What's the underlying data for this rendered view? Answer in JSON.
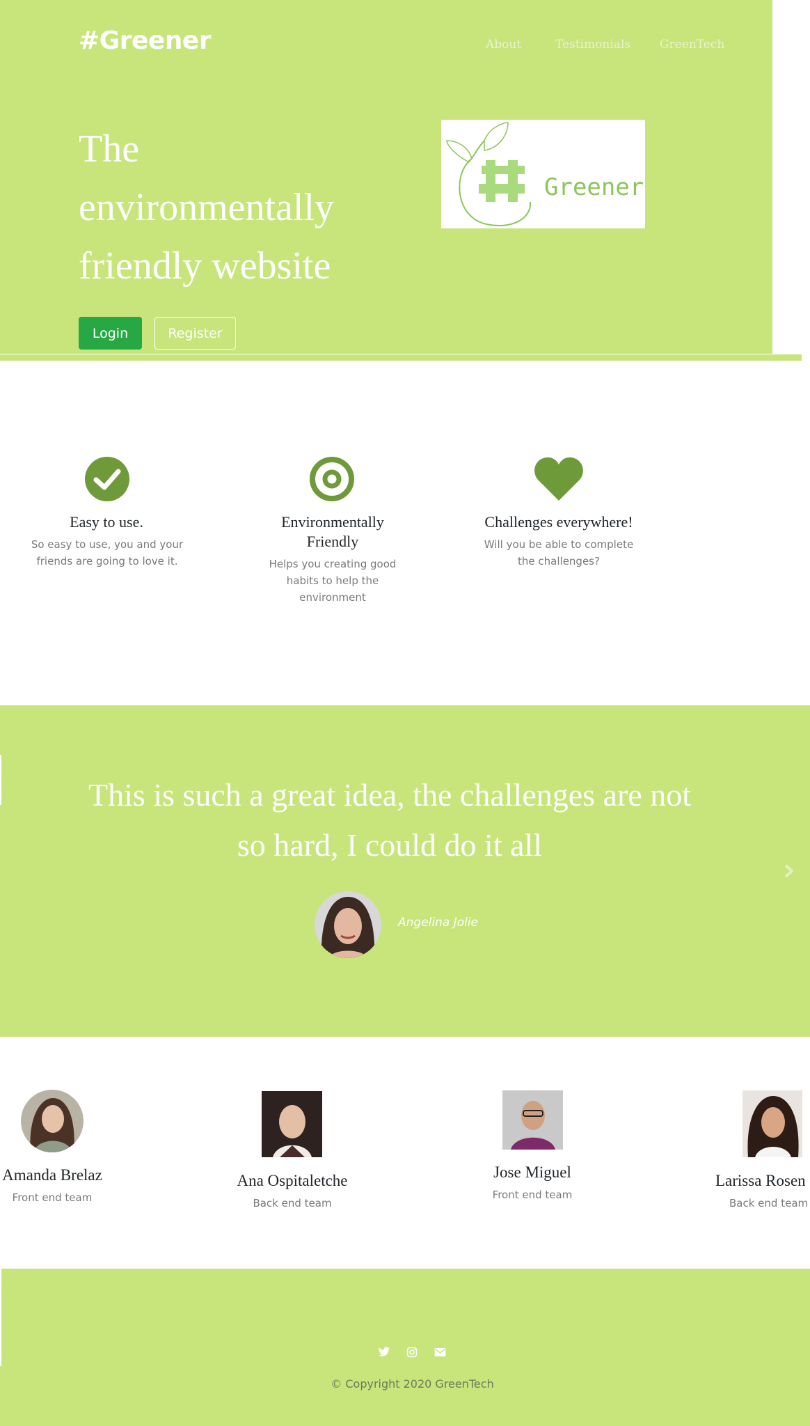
{
  "header": {
    "brand": "#Greener",
    "nav": [
      {
        "label": "About"
      },
      {
        "label": "Testimonials"
      },
      {
        "label": "GreenTech"
      }
    ]
  },
  "hero": {
    "title_lines": [
      "The",
      "environmentally",
      "friendly website"
    ],
    "login_label": "Login",
    "register_label": "Register",
    "logo_text": "Greener"
  },
  "features": [
    {
      "icon": "check-circle-icon",
      "title": "Easy to use.",
      "desc_lines": [
        "So easy to use, you and your",
        "friends are going to love it."
      ]
    },
    {
      "icon": "target-icon",
      "title_lines": [
        "Environmentally",
        "Friendly"
      ],
      "desc_lines": [
        "Helps you creating good",
        "habits to help the",
        "environment"
      ]
    },
    {
      "icon": "heart-icon",
      "title": "Challenges everywhere!",
      "desc_lines": [
        "Will you be able to complete",
        "the challenges?"
      ]
    }
  ],
  "testimonial": {
    "quote_lines": [
      "This is such a great idea, the challenges are not",
      "so hard, I could do it all"
    ],
    "author": "Angelina Jolie",
    "next_icon": "chevron-right-icon"
  },
  "team": [
    {
      "name": "Amanda Brelaz",
      "role": "Front end team"
    },
    {
      "name": "Ana Ospitaletche",
      "role": "Back end team"
    },
    {
      "name": "Jose Miguel",
      "role": "Front end team"
    },
    {
      "name": "Larissa Rosen",
      "role": "Back end team"
    }
  ],
  "footer": {
    "social_icons": [
      "twitter-icon",
      "instagram-icon",
      "envelope-icon"
    ],
    "copyright": "© Copyright 2020 GreenTech"
  },
  "colors": {
    "brand_green": "#c7e57b",
    "icon_green": "#6f9a3a",
    "login_green": "#28a745"
  }
}
